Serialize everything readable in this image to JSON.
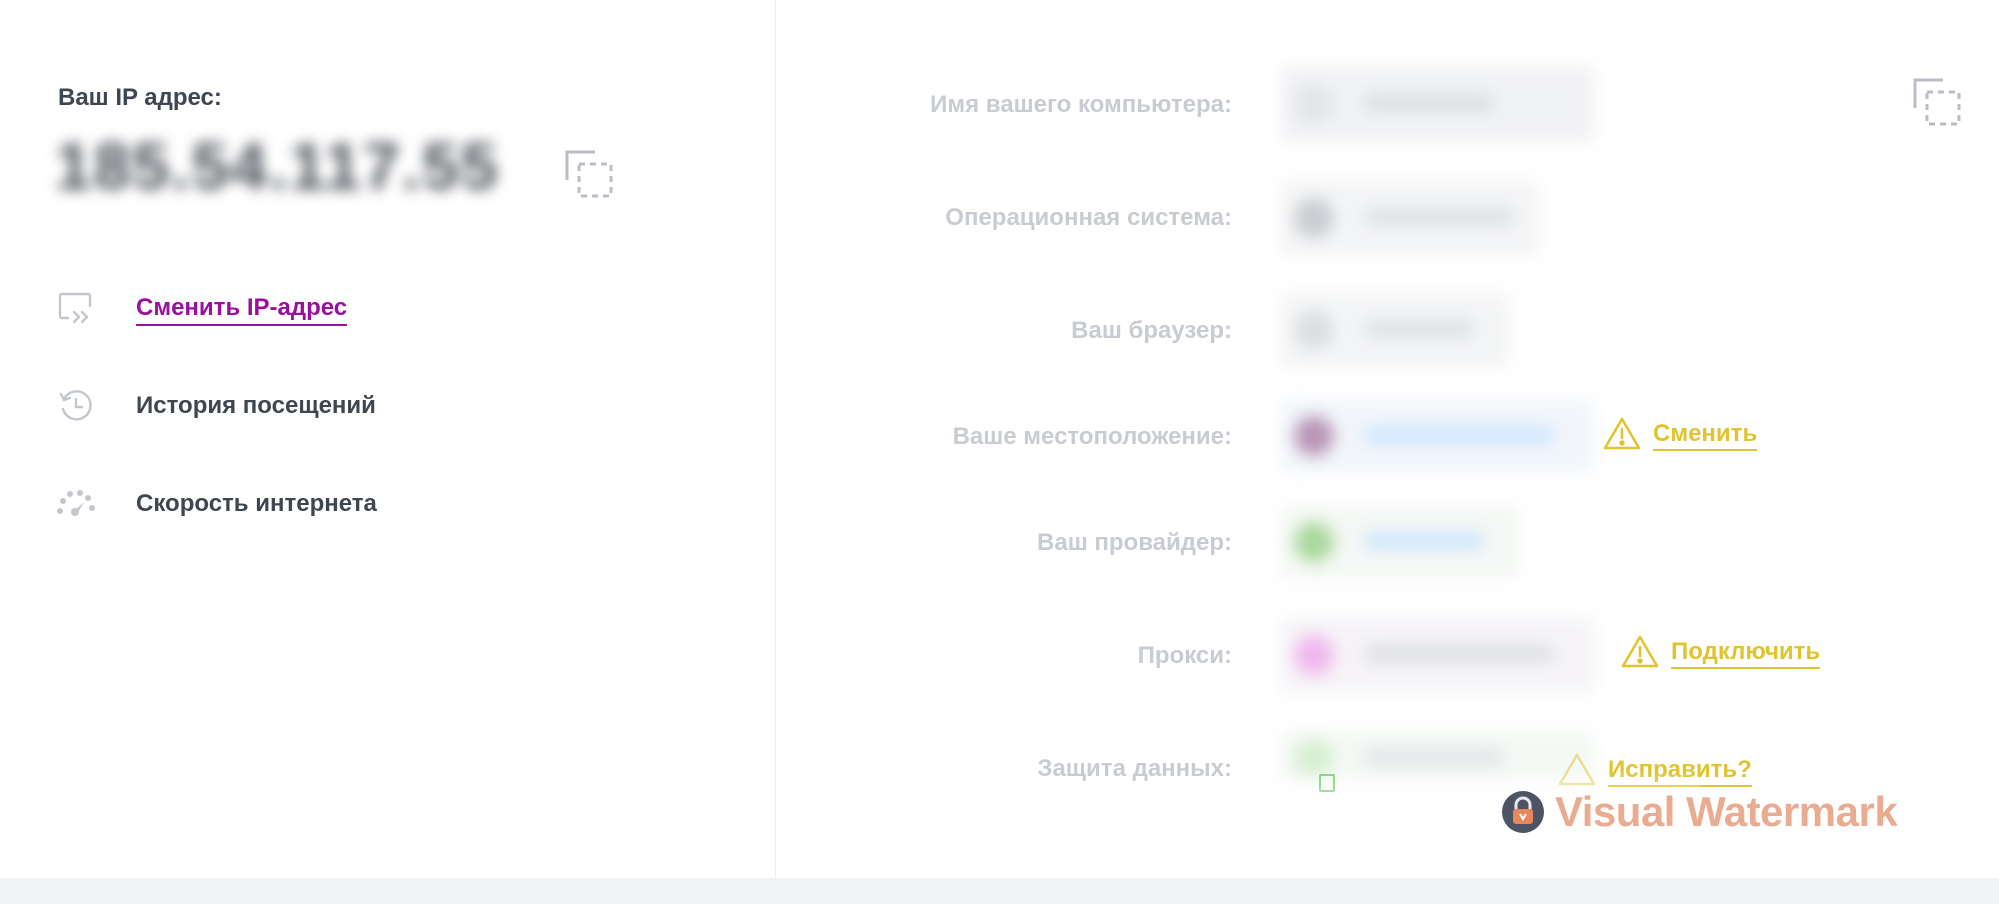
{
  "left_panel": {
    "ip_label": "Ваш IP адрес:",
    "ip_value": "185.54.117.55",
    "menu": [
      {
        "label": "Сменить IP-адрес",
        "icon": "switch-ip-icon",
        "active": true
      },
      {
        "label": "История посещений",
        "icon": "history-icon",
        "active": false
      },
      {
        "label": "Скорость интернета",
        "icon": "speedometer-icon",
        "active": false
      }
    ]
  },
  "right_panel": {
    "rows": [
      {
        "label": "Имя вашего компьютера:"
      },
      {
        "label": "Операционная система:"
      },
      {
        "label": "Ваш браузер:"
      },
      {
        "label": "Ваше местоположение:",
        "action": "Сменить"
      },
      {
        "label": "Ваш провайдер:"
      },
      {
        "label": "Прокси:",
        "action": "Подключить"
      },
      {
        "label": "Защита данных:",
        "action": "Исправить?"
      }
    ]
  },
  "watermark": {
    "text": "Visual Watermark"
  },
  "colors": {
    "accent": "#9a0f9e",
    "warning": "#e0c42e",
    "text_dark": "#3f4650",
    "text_muted": "#c8ccd1"
  }
}
